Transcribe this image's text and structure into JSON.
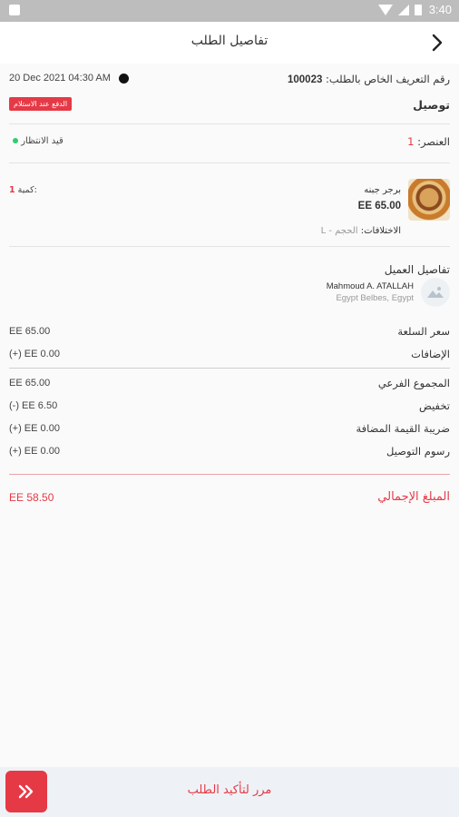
{
  "status_bar": {
    "time": "3:40"
  },
  "header": {
    "title": "تفاصيل الطلب"
  },
  "order": {
    "id_label": "رقم التعريف الخاص بالطلب:",
    "id_value": "100023",
    "date": "20 Dec 2021  04:30 AM",
    "type": "توصيل",
    "payment_badge": "الدفع عند الاستلام",
    "item_label": "العنصر:",
    "item_count": "1",
    "status": "قيد الانتظار"
  },
  "item": {
    "name": "برجر جبنه",
    "price": "EE 65.00",
    "quantity_label": "كمية:",
    "quantity": "1",
    "variations_label": "الاختلافات:",
    "variations_value": "الحجم - L"
  },
  "customer": {
    "section_title": "تفاصيل العميل",
    "name": "Mahmoud A. ATALLAH",
    "address": "Egypt Belbes, Egypt"
  },
  "summary": {
    "item_price_label": "سعر السلعة",
    "item_price": "EE 65.00",
    "addons_label": "الإضافات",
    "addons": "(+) EE 0.00",
    "subtotal_label": "المجموع الفرعي",
    "subtotal": "EE 65.00",
    "discount_label": "تخفيض",
    "discount": "(-) EE 6.50",
    "vat_label": "ضريبة القيمة المضافة",
    "vat": "(+) EE 0.00",
    "delivery_label": "رسوم التوصيل",
    "delivery": "(+) EE 0.00",
    "total_label": "المبلغ الإجمالي",
    "total": "EE 58.50"
  },
  "bottom": {
    "confirm_label": "مرر لتأكيد الطلب"
  },
  "colors": {
    "accent": "#e63946",
    "status_dot": "#2ecc71"
  }
}
